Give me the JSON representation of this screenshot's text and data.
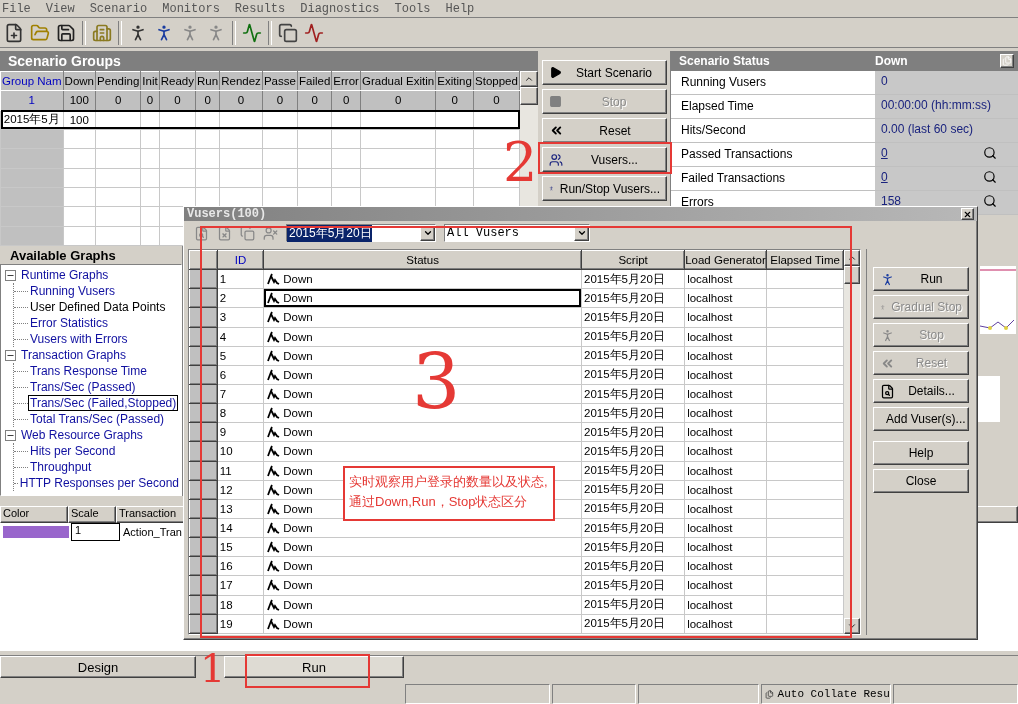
{
  "menu": [
    "File",
    "View",
    "Scenario",
    "Monitors",
    "Results",
    "Diagnostics",
    "Tools",
    "Help"
  ],
  "scenario_groups": {
    "title": "Scenario Groups",
    "columns": [
      "Group Nam",
      "Down",
      "Pending",
      "Init",
      "Ready",
      "Run",
      "Rendez",
      "Passe",
      "Failed",
      "Error",
      "Gradual Exitin",
      "Exiting",
      "Stopped"
    ],
    "totals": [
      "1",
      "100",
      "0",
      "0",
      "0",
      "0",
      "0",
      "0",
      "0",
      "0",
      "0",
      "0",
      "0"
    ],
    "rows": [
      {
        "cells": [
          "2015年5月",
          "100"
        ],
        "selected": true
      }
    ]
  },
  "control_buttons": [
    {
      "label": "Start Scenario",
      "disabled": false
    },
    {
      "label": "Stop",
      "disabled": true
    },
    {
      "label": "Reset",
      "disabled": false
    },
    {
      "label": "Vusers...",
      "disabled": false
    },
    {
      "label": "Run/Stop Vusers...",
      "disabled": false
    }
  ],
  "scenario_status": {
    "title": "Scenario Status",
    "state": "Down",
    "rows": [
      {
        "label": "Running Vusers",
        "value": "0",
        "link": false,
        "details": false
      },
      {
        "label": "Elapsed Time",
        "value": "00:00:00 (hh:mm:ss)",
        "link": false,
        "details": false
      },
      {
        "label": "Hits/Second",
        "value": "0.00 (last 60 sec)",
        "link": false,
        "details": false
      },
      {
        "label": "Passed Transactions",
        "value": "0",
        "link": true,
        "details": true
      },
      {
        "label": "Failed Transactions",
        "value": "0",
        "link": true,
        "details": true
      },
      {
        "label": "Errors",
        "value": "158",
        "link": false,
        "details": true
      }
    ]
  },
  "available_graphs": {
    "title": "Available Graphs",
    "tree": [
      {
        "label": "Runtime Graphs",
        "expanded": true,
        "children": [
          {
            "label": "Running Vusers",
            "available": true,
            "selected": false
          },
          {
            "label": "User Defined Data Points",
            "available": false,
            "selected": false
          },
          {
            "label": "Error Statistics",
            "available": true,
            "selected": false
          },
          {
            "label": "Vusers with Errors",
            "available": true,
            "selected": false
          }
        ]
      },
      {
        "label": "Transaction Graphs",
        "expanded": true,
        "children": [
          {
            "label": "Trans Response Time",
            "available": true,
            "selected": false
          },
          {
            "label": "Trans/Sec (Passed)",
            "available": true,
            "selected": false
          },
          {
            "label": "Trans/Sec (Failed,Stopped)",
            "available": true,
            "selected": true
          },
          {
            "label": "Total Trans/Sec (Passed)",
            "available": true,
            "selected": false
          }
        ]
      },
      {
        "label": "Web Resource Graphs",
        "expanded": true,
        "children": [
          {
            "label": "Hits per Second",
            "available": true,
            "selected": false
          },
          {
            "label": "Throughput",
            "available": true,
            "selected": false
          },
          {
            "label": "HTTP Responses per Second",
            "available": true,
            "selected": false
          }
        ]
      }
    ]
  },
  "graph_legend": {
    "columns": [
      "Color",
      "Scale",
      "Transaction"
    ],
    "rows": [
      {
        "color": "#9966cc",
        "scale": "1",
        "transaction": "Action_Tran"
      }
    ]
  },
  "tabs": [
    {
      "label": "Design",
      "selected": false
    },
    {
      "label": "Run",
      "selected": true
    }
  ],
  "status_bar": {
    "auto_collate": "Auto Collate Resu"
  },
  "vusers_dialog": {
    "title": "Vusers(100)",
    "group_filter": "2015年5月20日",
    "vuser_filter": "All Vusers",
    "columns": [
      "ID",
      "Status",
      "Script",
      "Load Generator",
      "Elapsed Time"
    ],
    "rows": [
      {
        "id": "1",
        "status": "Down",
        "script": "2015年5月20日",
        "load_generator": "localhost",
        "selected": false
      },
      {
        "id": "2",
        "status": "Down",
        "script": "2015年5月20日",
        "load_generator": "localhost",
        "selected": true
      },
      {
        "id": "3",
        "status": "Down",
        "script": "2015年5月20日",
        "load_generator": "localhost",
        "selected": false
      },
      {
        "id": "4",
        "status": "Down",
        "script": "2015年5月20日",
        "load_generator": "localhost",
        "selected": false
      },
      {
        "id": "5",
        "status": "Down",
        "script": "2015年5月20日",
        "load_generator": "localhost",
        "selected": false
      },
      {
        "id": "6",
        "status": "Down",
        "script": "2015年5月20日",
        "load_generator": "localhost",
        "selected": false
      },
      {
        "id": "7",
        "status": "Down",
        "script": "2015年5月20日",
        "load_generator": "localhost",
        "selected": false
      },
      {
        "id": "8",
        "status": "Down",
        "script": "2015年5月20日",
        "load_generator": "localhost",
        "selected": false
      },
      {
        "id": "9",
        "status": "Down",
        "script": "2015年5月20日",
        "load_generator": "localhost",
        "selected": false
      },
      {
        "id": "10",
        "status": "Down",
        "script": "2015年5月20日",
        "load_generator": "localhost",
        "selected": false
      },
      {
        "id": "11",
        "status": "Down",
        "script": "2015年5月20日",
        "load_generator": "localhost",
        "selected": false
      },
      {
        "id": "12",
        "status": "Down",
        "script": "2015年5月20日",
        "load_generator": "localhost",
        "selected": false
      },
      {
        "id": "13",
        "status": "Down",
        "script": "2015年5月20日",
        "load_generator": "localhost",
        "selected": false
      },
      {
        "id": "14",
        "status": "Down",
        "script": "2015年5月20日",
        "load_generator": "localhost",
        "selected": false
      },
      {
        "id": "15",
        "status": "Down",
        "script": "2015年5月20日",
        "load_generator": "localhost",
        "selected": false
      },
      {
        "id": "16",
        "status": "Down",
        "script": "2015年5月20日",
        "load_generator": "localhost",
        "selected": false
      },
      {
        "id": "17",
        "status": "Down",
        "script": "2015年5月20日",
        "load_generator": "localhost",
        "selected": false
      },
      {
        "id": "18",
        "status": "Down",
        "script": "2015年5月20日",
        "load_generator": "localhost",
        "selected": false
      },
      {
        "id": "19",
        "status": "Down",
        "script": "2015年5月20日",
        "load_generator": "localhost",
        "selected": false
      }
    ],
    "buttons": [
      {
        "label": "Run",
        "disabled": false
      },
      {
        "label": "Gradual Stop",
        "disabled": true
      },
      {
        "label": "Stop",
        "disabled": true
      },
      {
        "label": "Reset",
        "disabled": true
      },
      {
        "label": "Details...",
        "disabled": false
      },
      {
        "label": "Add Vuser(s)...",
        "disabled": false
      },
      {
        "label": "Help",
        "disabled": false
      },
      {
        "label": "Close",
        "disabled": false
      }
    ]
  },
  "annotations": {
    "marks": [
      "2",
      "3",
      "1"
    ],
    "note": [
      "实时观察用户登录的数量以及状态,",
      "通过Down,Run，Stop状态区分"
    ]
  }
}
